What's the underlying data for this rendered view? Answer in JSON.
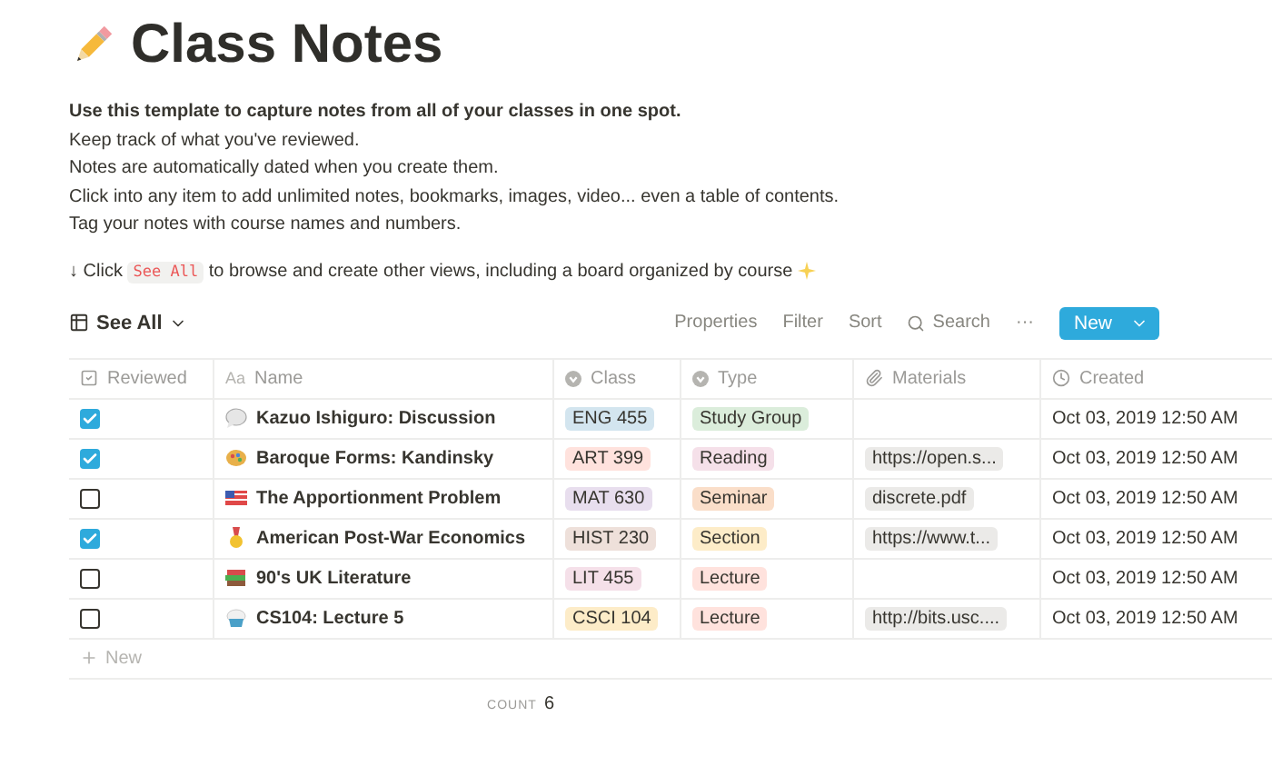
{
  "page": {
    "title": "Class Notes"
  },
  "intro": {
    "headline": "Use this template to capture notes from all of your classes in one spot.",
    "lines": [
      "Keep track of what you've reviewed.",
      "Notes are automatically dated when you create them.",
      "Click into any item to add unlimited notes, bookmarks, images, video... even a table of contents.",
      "Tag your notes with course names and numbers."
    ],
    "hint": {
      "arrow": "↓",
      "before": "Click",
      "code": "See All",
      "after": "to browse and create other views, including a board organized by course"
    }
  },
  "view": {
    "name": "See All",
    "actions": [
      "Properties",
      "Filter",
      "Sort",
      "Search",
      "···"
    ],
    "new_button": "New"
  },
  "table": {
    "columns": [
      {
        "kind": "check",
        "label": "Reviewed"
      },
      {
        "kind": "title",
        "label": "Name",
        "glyph": "Aa"
      },
      {
        "kind": "select",
        "label": "Class"
      },
      {
        "kind": "select",
        "label": "Type"
      },
      {
        "kind": "file",
        "label": "Materials"
      },
      {
        "kind": "date",
        "label": "Created"
      }
    ],
    "rows": [
      {
        "reviewed": true,
        "name": "Kazuo Ishiguro: Discussion",
        "class": {
          "label": "ENG 455",
          "color": "#d3e5ef"
        },
        "type": {
          "label": "Study Group",
          "color": "#dbeddb"
        },
        "created": "Oct 03, 2019 12:50 AM"
      },
      {
        "reviewed": true,
        "name": "Baroque Forms: Kandinsky",
        "class": {
          "label": "ART 399",
          "color": "#ffe2dd"
        },
        "type": {
          "label": "Reading",
          "color": "#f5e0e9"
        },
        "materials": "https://open.s...",
        "created": "Oct 03, 2019 12:50 AM"
      },
      {
        "reviewed": false,
        "name": "The Apportionment Problem",
        "class": {
          "label": "MAT 630",
          "color": "#e8deee"
        },
        "type": {
          "label": "Seminar",
          "color": "#fadec9"
        },
        "materials": "discrete.pdf",
        "created": "Oct 03, 2019 12:50 AM"
      },
      {
        "reviewed": true,
        "name": "American Post-War Economics",
        "class": {
          "label": "HIST 230",
          "color": "#eee0da"
        },
        "type": {
          "label": "Section",
          "color": "#fdecc8"
        },
        "materials": "https://www.t...",
        "created": "Oct 03, 2019 12:50 AM"
      },
      {
        "reviewed": false,
        "name": "90's UK Literature",
        "class": {
          "label": "LIT 455",
          "color": "#f5e0e9"
        },
        "type": {
          "label": "Lecture",
          "color": "#ffe2dd"
        },
        "created": "Oct 03, 2019 12:50 AM"
      },
      {
        "reviewed": false,
        "name": "CS104: Lecture 5",
        "class": {
          "label": "CSCI 104",
          "color": "#fdecc8"
        },
        "type": {
          "label": "Lecture",
          "color": "#ffe2dd"
        },
        "materials": "http://bits.usc....",
        "created": "Oct 03, 2019 12:50 AM"
      }
    ],
    "add_row": "New",
    "footer": {
      "label": "COUNT",
      "value": "6"
    }
  }
}
